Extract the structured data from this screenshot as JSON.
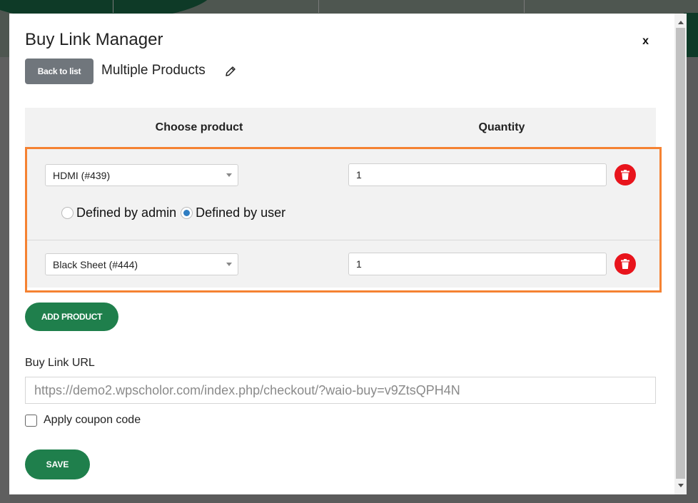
{
  "modal": {
    "title": "Buy Link Manager",
    "close_label": "x",
    "back_label": "Back to list",
    "link_name": "Multiple Products"
  },
  "table": {
    "headers": {
      "product": "Choose product",
      "quantity": "Quantity"
    },
    "rows": [
      {
        "product": "HDMI (#439)",
        "quantity": "1"
      },
      {
        "product": "Black Sheet (#444)",
        "quantity": "1"
      }
    ],
    "radio": {
      "options": [
        "Defined by admin",
        "Defined by user"
      ],
      "selected": "Defined by user"
    }
  },
  "add_product_label": "ADD PRODUCT",
  "url": {
    "label": "Buy Link URL",
    "value": "https://demo2.wpscholor.com/index.php/checkout/?waio-buy=v9ZtsQPH4N"
  },
  "coupon_label": "Apply coupon code",
  "save_label": "SAVE",
  "colors": {
    "accent_green": "#1f7f4c",
    "highlight_orange": "#f58232",
    "delete_red": "#e8141c",
    "back_button_gray": "#70767c"
  },
  "icons": [
    "close-icon",
    "edit-pencil-icon",
    "trash-icon",
    "chevron-down-icon"
  ]
}
